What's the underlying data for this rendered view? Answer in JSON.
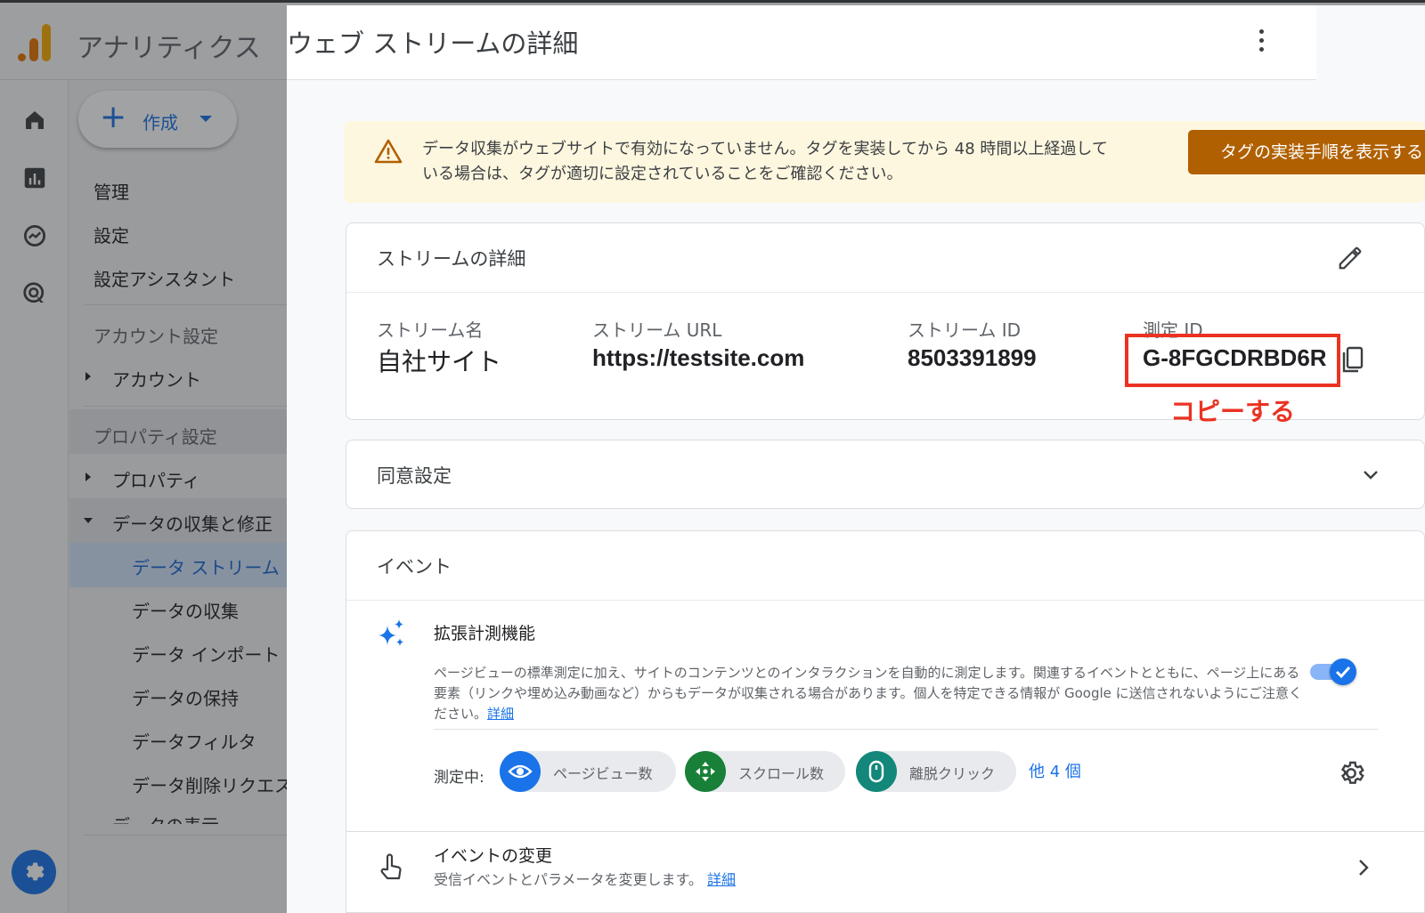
{
  "app": {
    "title": "アナリティクス",
    "create_label": "作成",
    "nav": {
      "admin": "管理",
      "settings": "設定",
      "setup_assistant": "設定アシスタント",
      "account_settings": "アカウント設定",
      "account": "アカウント",
      "property_settings": "プロパティ設定",
      "property": "プロパティ",
      "data_collection_section": "データの収集と修正",
      "data_streams": "データ ストリーム",
      "data_collection": "データの収集",
      "data_import": "データ インポート",
      "data_retention": "データの保持",
      "data_filters": "データフィルタ",
      "data_deletion": "データ削除リクエスト",
      "data_display": "データの表示"
    }
  },
  "panel": {
    "title": "ウェブ ストリームの詳細",
    "alert": {
      "text": "データ収集がウェブサイトで有効になっていません。タグを実装してから 48 時間以上経過している場合は、タグが適切に設定されていることをご確認ください。",
      "button": "タグの実装手順を表示する"
    },
    "stream_details": {
      "title": "ストリームの詳細",
      "fields": [
        {
          "label": "ストリーム名",
          "value": "自社サイト"
        },
        {
          "label": "ストリーム URL",
          "value": "https://testsite.com"
        },
        {
          "label": "ストリーム ID",
          "value": "8503391899"
        },
        {
          "label": "測定 ID",
          "value": "G-8FGCDRBD6R"
        }
      ],
      "annotation": "コピーする"
    },
    "consent": {
      "title": "同意設定"
    },
    "events": {
      "title": "イベント",
      "enhanced": {
        "title": "拡張計測機能",
        "description": "ページビューの標準測定に加え、サイトのコンテンツとのインタラクションを自動的に測定します。関連するイベントとともに、ページ上にある要素（リンクや埋め込み動画など）からもデータが収集される場合があります。個人を特定できる情報が Google に送信されないようにご注意ください。",
        "learn_more": "詳細",
        "enabled": true,
        "measuring_label": "測定中:",
        "chips": [
          {
            "label": "ページビュー数",
            "color": "#1a73e8",
            "icon": "eye-icon"
          },
          {
            "label": "スクロール数",
            "color": "#188038",
            "icon": "scroll-icon"
          },
          {
            "label": "離脱クリック",
            "color": "#12877a",
            "icon": "mouse-icon"
          }
        ],
        "more": "他 4 個"
      }
    },
    "event_change": {
      "title": "イベントの変更",
      "description": "受信イベントとパラメータを変更します。",
      "learn_more": "詳細"
    }
  },
  "colors": {
    "primary": "#1a73e8",
    "warning_button": "#b06000",
    "annotation_red": "#ea3323",
    "alert_bg": "#fef7e0"
  }
}
